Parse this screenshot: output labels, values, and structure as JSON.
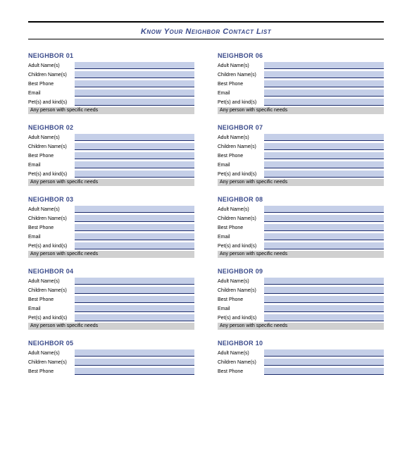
{
  "title": "Know Your Neighbor Contact List",
  "fields": {
    "adult": "Adult Name(s)",
    "children": "Children Name(s)",
    "phone": "Best Phone",
    "email": "Email",
    "pets": "Pet(s) and kind(s)",
    "needs": "Any person with specific needs"
  },
  "neighbor_label": "NEIGHBOR",
  "neighbors": [
    {
      "num": "01"
    },
    {
      "num": "06"
    },
    {
      "num": "02"
    },
    {
      "num": "07"
    },
    {
      "num": "03"
    },
    {
      "num": "08"
    },
    {
      "num": "04"
    },
    {
      "num": "09"
    },
    {
      "num": "05"
    },
    {
      "num": "10"
    }
  ]
}
